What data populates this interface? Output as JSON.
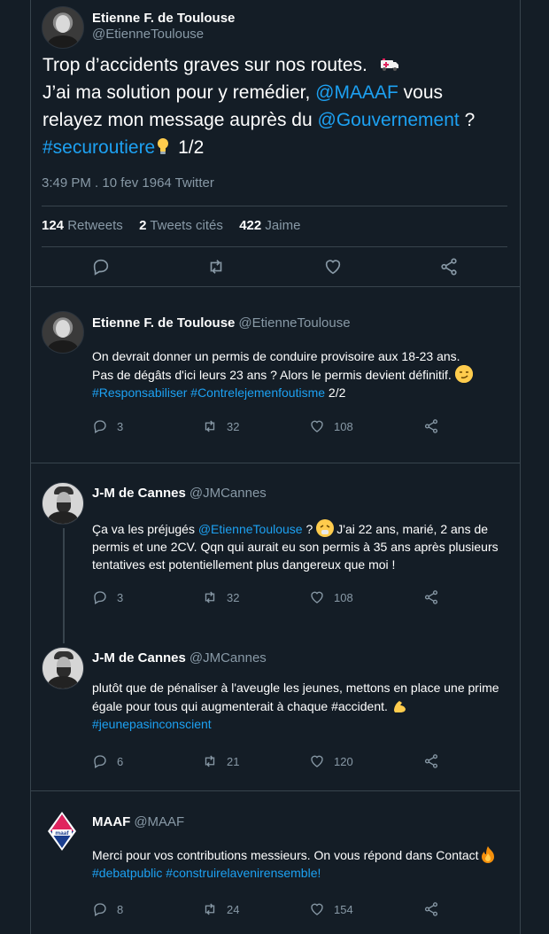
{
  "main_tweet": {
    "name": "Etienne F. de Toulouse",
    "handle": "@EtienneToulouse",
    "line1": "Trop d’accidents graves sur nos routes.",
    "line2_start": "J’ai ma solution pour y remédier,",
    "mention1": "@MAAAF",
    "line2_end": "vous",
    "line3_start": "relayez mon message auprès du",
    "mention2": "@Gouvernement",
    "line3_end": "?",
    "hashtag": "#securoutiere",
    "count": "1/2",
    "meta": "3:49 PM . 10 fev 1964 Twitter",
    "stats": {
      "retweets_value": "124",
      "retweets_label": "Retweets",
      "quotes_value": "2",
      "quotes_label": "Tweets cités",
      "likes_value": "422",
      "likes_label": "Jaime"
    }
  },
  "replies": [
    {
      "name": "Etienne F. de Toulouse",
      "handle": "@EtienneToulouse",
      "line1": "On devrait donner un permis de conduire provisoire aux 18-23 ans.",
      "line2": "Pas de dégâts d'ici leurs 23 ans ? Alors le permis devient définitif.",
      "hashtags": "#Responsabiliser #Contrelejemenfoutisme",
      "count": "2/2",
      "reply_count": "3",
      "retweet_count": "32",
      "like_count": "108"
    },
    {
      "name": "J-M de Cannes",
      "handle": "@JMCannes",
      "text_start": "Ça va les préjugés",
      "mention": "@EtienneToulouse",
      "text_mid": "?",
      "text_end": "J'ai 22 ans, marié, 2 ans de permis et une 2CV. Qqn qui aurait eu son permis à 35 ans après plusieurs tentatives est potentiellement plus dangereux que moi !",
      "reply_count": "3",
      "retweet_count": "32",
      "like_count": "108"
    },
    {
      "name": "J-M de Cannes",
      "handle": "@JMCannes",
      "text": "plutôt que de pénaliser à l'aveugle les jeunes, mettons en place une prime égale pour tous qui augmenterait à chaque #accident.",
      "hashtag": "#jeunepasinconscient",
      "reply_count": "6",
      "retweet_count": "21",
      "like_count": "120"
    },
    {
      "name": "MAAF",
      "handle": "@MAAF",
      "logo_text": "maaf",
      "text": "Merci pour vos contributions messieurs. On vous répond dans Contact",
      "hashtags": "#debatpublic #construirelavenirensemble!",
      "reply_count": "8",
      "retweet_count": "24",
      "like_count": "154"
    }
  ],
  "icons": {
    "reply": "reply-icon",
    "retweet": "retweet-icon",
    "like": "heart-icon",
    "share": "share-icon"
  },
  "colors": {
    "background": "#141d26",
    "link": "#1da1f2",
    "muted": "#8899a6",
    "border": "#38444d"
  }
}
